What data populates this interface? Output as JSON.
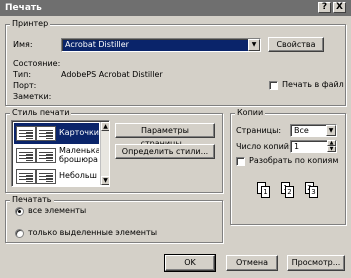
{
  "window": {
    "title": "Печать",
    "help_button": "?",
    "close_button": "X"
  },
  "printer": {
    "group_label": "Принтер",
    "name_label": "Имя:",
    "name_value": "Acrobat Distiller",
    "properties_button": "Свойства",
    "status_label": "Состояние:",
    "type_label": "Тип:",
    "type_value": "AdobePS Acrobat Distiller",
    "port_label": "Порт:",
    "comment_label": "Заметки:",
    "print_to_file_label": "Печать в файл",
    "print_to_file_checked": false
  },
  "print_style": {
    "group_label": "Стиль печати",
    "items": [
      {
        "label": "Карточки",
        "selected": true
      },
      {
        "label": "Маленька брошюра",
        "selected": false
      },
      {
        "label": "Небольш",
        "selected": false
      }
    ],
    "page_setup_button": "Параметры страницы...",
    "define_styles_button": "Определить стили..."
  },
  "copies": {
    "group_label": "Копии",
    "pages_label": "Страницы:",
    "pages_value": "Все",
    "count_label": "Число копий:",
    "count_value": "1",
    "collate_label": "Разобрать по копиям",
    "collate_checked": false,
    "collate_pages": [
      "1",
      "1",
      "2",
      "2",
      "3"
    ]
  },
  "print_range": {
    "group_label": "Печатать",
    "all_label": "все элементы",
    "selected_label": "только выделенные элементы",
    "selected_option": "all"
  },
  "buttons": {
    "ok": "OK",
    "cancel": "Отмена",
    "preview": "Просмотр..."
  },
  "icons": {
    "dropdown": "chevron-down-icon",
    "spin_up": "spin-up-icon",
    "spin_down": "spin-down-icon"
  }
}
